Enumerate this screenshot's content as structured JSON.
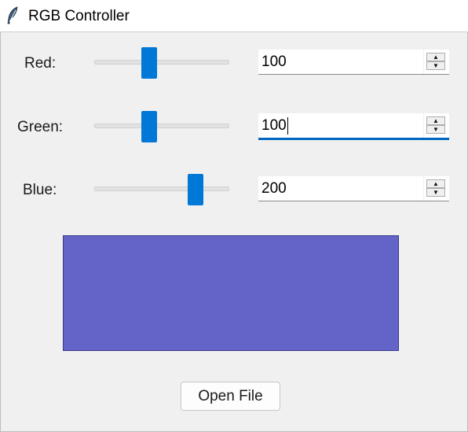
{
  "window": {
    "title": "RGB Controller",
    "icon": "feather-icon"
  },
  "controls": {
    "red": {
      "label": "Red:",
      "value": "100",
      "slider_value": 100,
      "min": 0,
      "max": 255
    },
    "green": {
      "label": "Green:",
      "value": "100",
      "slider_value": 100,
      "min": 0,
      "max": 255,
      "focused": true
    },
    "blue": {
      "label": "Blue:",
      "value": "200",
      "slider_value": 200,
      "min": 0,
      "max": 255
    }
  },
  "preview": {
    "color": "#6464c8"
  },
  "buttons": {
    "open_file": "Open File"
  },
  "colors": {
    "accent": "#0078d7",
    "focus_underline": "#0067c0",
    "background": "#f0f0f0"
  }
}
